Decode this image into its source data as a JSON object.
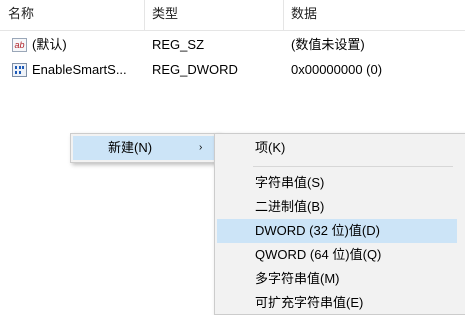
{
  "columns": {
    "name": "名称",
    "type": "类型",
    "data": "数据"
  },
  "rows": [
    {
      "icon": "string-value-icon",
      "icon_text": "ab",
      "name": "(默认)",
      "type": "REG_SZ",
      "data": "(数值未设置)"
    },
    {
      "icon": "binary-value-icon",
      "name": "EnableSmartS...",
      "type": "REG_DWORD",
      "data": "0x00000000 (0)"
    }
  ],
  "context_menu": {
    "new_label": "新建(N)",
    "submenu_arrow": "›"
  },
  "submenu": {
    "items": [
      {
        "label": "项(K)"
      },
      {
        "label": "字符串值(S)"
      },
      {
        "label": "二进制值(B)"
      },
      {
        "label": "DWORD (32 位)值(D)",
        "highlighted": true
      },
      {
        "label": "QWORD (64 位)值(Q)"
      },
      {
        "label": "多字符串值(M)"
      },
      {
        "label": "可扩充字符串值(E)"
      }
    ]
  },
  "colors": {
    "highlight": "#cce4f7",
    "menu_bg": "#f2f2f2"
  }
}
